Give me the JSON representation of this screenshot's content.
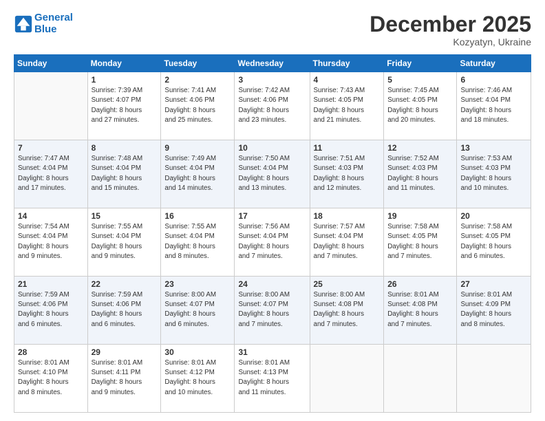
{
  "header": {
    "logo_line1": "General",
    "logo_line2": "Blue",
    "month": "December 2025",
    "location": "Kozyatyn, Ukraine"
  },
  "days_of_week": [
    "Sunday",
    "Monday",
    "Tuesday",
    "Wednesday",
    "Thursday",
    "Friday",
    "Saturday"
  ],
  "weeks": [
    [
      {
        "day": "",
        "info": ""
      },
      {
        "day": "1",
        "info": "Sunrise: 7:39 AM\nSunset: 4:07 PM\nDaylight: 8 hours\nand 27 minutes."
      },
      {
        "day": "2",
        "info": "Sunrise: 7:41 AM\nSunset: 4:06 PM\nDaylight: 8 hours\nand 25 minutes."
      },
      {
        "day": "3",
        "info": "Sunrise: 7:42 AM\nSunset: 4:06 PM\nDaylight: 8 hours\nand 23 minutes."
      },
      {
        "day": "4",
        "info": "Sunrise: 7:43 AM\nSunset: 4:05 PM\nDaylight: 8 hours\nand 21 minutes."
      },
      {
        "day": "5",
        "info": "Sunrise: 7:45 AM\nSunset: 4:05 PM\nDaylight: 8 hours\nand 20 minutes."
      },
      {
        "day": "6",
        "info": "Sunrise: 7:46 AM\nSunset: 4:04 PM\nDaylight: 8 hours\nand 18 minutes."
      }
    ],
    [
      {
        "day": "7",
        "info": "Sunrise: 7:47 AM\nSunset: 4:04 PM\nDaylight: 8 hours\nand 17 minutes."
      },
      {
        "day": "8",
        "info": "Sunrise: 7:48 AM\nSunset: 4:04 PM\nDaylight: 8 hours\nand 15 minutes."
      },
      {
        "day": "9",
        "info": "Sunrise: 7:49 AM\nSunset: 4:04 PM\nDaylight: 8 hours\nand 14 minutes."
      },
      {
        "day": "10",
        "info": "Sunrise: 7:50 AM\nSunset: 4:04 PM\nDaylight: 8 hours\nand 13 minutes."
      },
      {
        "day": "11",
        "info": "Sunrise: 7:51 AM\nSunset: 4:03 PM\nDaylight: 8 hours\nand 12 minutes."
      },
      {
        "day": "12",
        "info": "Sunrise: 7:52 AM\nSunset: 4:03 PM\nDaylight: 8 hours\nand 11 minutes."
      },
      {
        "day": "13",
        "info": "Sunrise: 7:53 AM\nSunset: 4:03 PM\nDaylight: 8 hours\nand 10 minutes."
      }
    ],
    [
      {
        "day": "14",
        "info": "Sunrise: 7:54 AM\nSunset: 4:04 PM\nDaylight: 8 hours\nand 9 minutes."
      },
      {
        "day": "15",
        "info": "Sunrise: 7:55 AM\nSunset: 4:04 PM\nDaylight: 8 hours\nand 9 minutes."
      },
      {
        "day": "16",
        "info": "Sunrise: 7:55 AM\nSunset: 4:04 PM\nDaylight: 8 hours\nand 8 minutes."
      },
      {
        "day": "17",
        "info": "Sunrise: 7:56 AM\nSunset: 4:04 PM\nDaylight: 8 hours\nand 7 minutes."
      },
      {
        "day": "18",
        "info": "Sunrise: 7:57 AM\nSunset: 4:04 PM\nDaylight: 8 hours\nand 7 minutes."
      },
      {
        "day": "19",
        "info": "Sunrise: 7:58 AM\nSunset: 4:05 PM\nDaylight: 8 hours\nand 7 minutes."
      },
      {
        "day": "20",
        "info": "Sunrise: 7:58 AM\nSunset: 4:05 PM\nDaylight: 8 hours\nand 6 minutes."
      }
    ],
    [
      {
        "day": "21",
        "info": "Sunrise: 7:59 AM\nSunset: 4:06 PM\nDaylight: 8 hours\nand 6 minutes."
      },
      {
        "day": "22",
        "info": "Sunrise: 7:59 AM\nSunset: 4:06 PM\nDaylight: 8 hours\nand 6 minutes."
      },
      {
        "day": "23",
        "info": "Sunrise: 8:00 AM\nSunset: 4:07 PM\nDaylight: 8 hours\nand 6 minutes."
      },
      {
        "day": "24",
        "info": "Sunrise: 8:00 AM\nSunset: 4:07 PM\nDaylight: 8 hours\nand 7 minutes."
      },
      {
        "day": "25",
        "info": "Sunrise: 8:00 AM\nSunset: 4:08 PM\nDaylight: 8 hours\nand 7 minutes."
      },
      {
        "day": "26",
        "info": "Sunrise: 8:01 AM\nSunset: 4:08 PM\nDaylight: 8 hours\nand 7 minutes."
      },
      {
        "day": "27",
        "info": "Sunrise: 8:01 AM\nSunset: 4:09 PM\nDaylight: 8 hours\nand 8 minutes."
      }
    ],
    [
      {
        "day": "28",
        "info": "Sunrise: 8:01 AM\nSunset: 4:10 PM\nDaylight: 8 hours\nand 8 minutes."
      },
      {
        "day": "29",
        "info": "Sunrise: 8:01 AM\nSunset: 4:11 PM\nDaylight: 8 hours\nand 9 minutes."
      },
      {
        "day": "30",
        "info": "Sunrise: 8:01 AM\nSunset: 4:12 PM\nDaylight: 8 hours\nand 10 minutes."
      },
      {
        "day": "31",
        "info": "Sunrise: 8:01 AM\nSunset: 4:13 PM\nDaylight: 8 hours\nand 11 minutes."
      },
      {
        "day": "",
        "info": ""
      },
      {
        "day": "",
        "info": ""
      },
      {
        "day": "",
        "info": ""
      }
    ]
  ]
}
